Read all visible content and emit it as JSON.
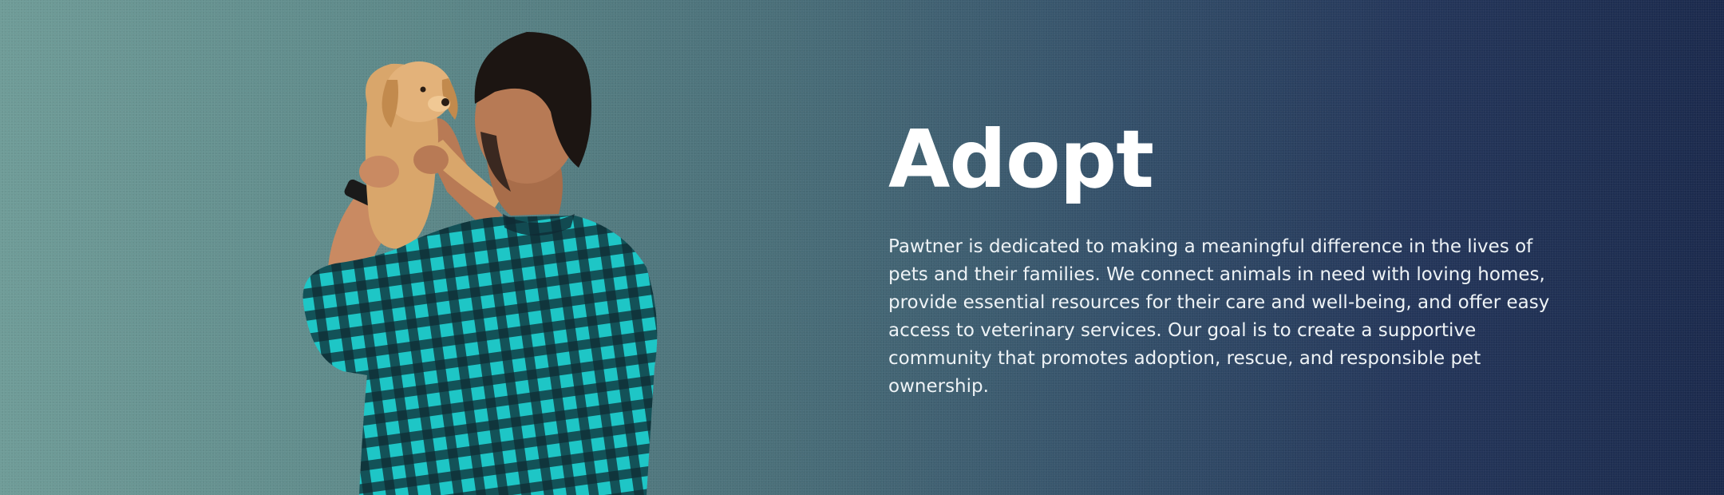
{
  "hero": {
    "title": "Adopt",
    "description": "Pawtner is dedicated to making a meaningful difference in the lives of pets and their families. We connect animals in need with loving homes, provide essential resources for their care and well-being, and offer easy access to veterinary services. Our goal is to create a supportive community that promotes adoption, rescue, and responsible pet ownership."
  },
  "colors": {
    "gradient_start": "#6f9c98",
    "gradient_end": "#1b2a4d",
    "shirt_primary": "#1ec6c6",
    "shirt_dark": "#0f2b33",
    "puppy": "#d9a66b",
    "text": "#ffffff"
  },
  "icons": {
    "hero_image": "man-holding-puppy-illustration"
  }
}
